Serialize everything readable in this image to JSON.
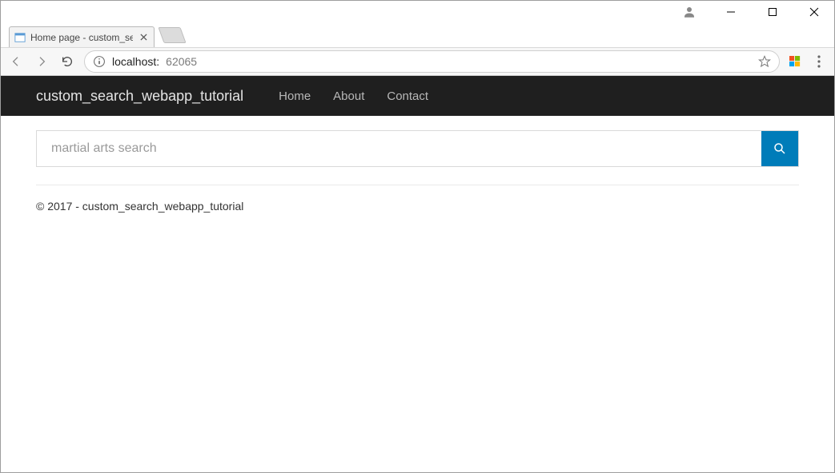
{
  "window": {
    "tab_title": "Home page - custom_se"
  },
  "address_bar": {
    "host": "localhost:",
    "port": "62065"
  },
  "navbar": {
    "brand": "custom_search_webapp_tutorial",
    "links": {
      "home": "Home",
      "about": "About",
      "contact": "Contact"
    }
  },
  "search": {
    "placeholder": "martial arts search"
  },
  "footer": {
    "text": "© 2017 - custom_search_webapp_tutorial"
  }
}
